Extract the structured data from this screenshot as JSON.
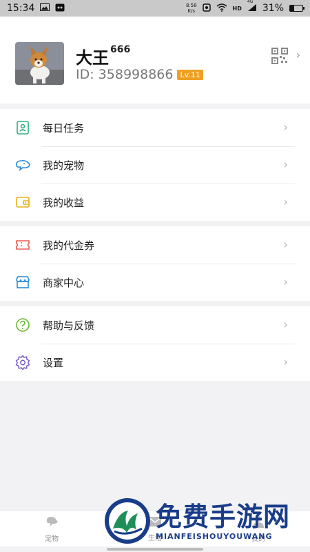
{
  "status_bar": {
    "time": "15:34",
    "net_speed_value": "8.58",
    "net_speed_unit": "K/s",
    "network_label": "HD",
    "signal_label": "4G",
    "battery_percent": "31%"
  },
  "profile": {
    "name": "大王",
    "name_suffix": "666",
    "id_text": "ID: 358998866",
    "level": "Lv.11"
  },
  "menu_groups": [
    {
      "items": [
        {
          "label": "每日任务",
          "icon": "task-badge-icon",
          "color": "#2bb37a"
        },
        {
          "label": "我的宠物",
          "icon": "pet-icon",
          "color": "#2a8bd6"
        },
        {
          "label": "我的收益",
          "icon": "wallet-icon",
          "color": "#e8b21a"
        }
      ]
    },
    {
      "items": [
        {
          "label": "我的代金券",
          "icon": "coupon-icon",
          "color": "#e85a4f"
        },
        {
          "label": "商家中心",
          "icon": "store-icon",
          "color": "#2a8bd6"
        }
      ]
    },
    {
      "items": [
        {
          "label": "帮助与反馈",
          "icon": "help-icon",
          "color": "#6ab733"
        },
        {
          "label": "设置",
          "icon": "settings-gear-icon",
          "color": "#7a5cc7"
        }
      ]
    }
  ],
  "tabbar": {
    "tabs": [
      {
        "label": "宠物",
        "icon": "pet-tab-icon"
      },
      {
        "label": "生活",
        "icon": "mail-tab-icon"
      },
      {
        "label": "我的",
        "icon": "profile-tab-icon"
      }
    ]
  },
  "watermark": {
    "big": "免费手游网",
    "small": "MIANFEISHOUYOUWANG"
  }
}
